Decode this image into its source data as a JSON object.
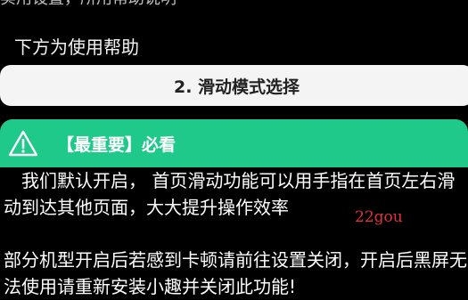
{
  "top_cut_text": "实用设置，所用帮助说明",
  "help": {
    "title": "下方为使用帮助"
  },
  "mode_button": {
    "label": "2. 滑动模式选择"
  },
  "banner": {
    "icon": "warning-triangle-icon",
    "text": "【最重要】必看",
    "color": "#1fc98a"
  },
  "paragraphs": [
    "我们默认开启， 首页滑动功能可以用手指在首页左右滑动到达其他页面，大大提升操作效率",
    "部分机型开启后若感到卡顿请前往设置关闭，开启后黑屏无法使用请重新安装小趣并关闭此功能!"
  ],
  "watermark": "22gou"
}
